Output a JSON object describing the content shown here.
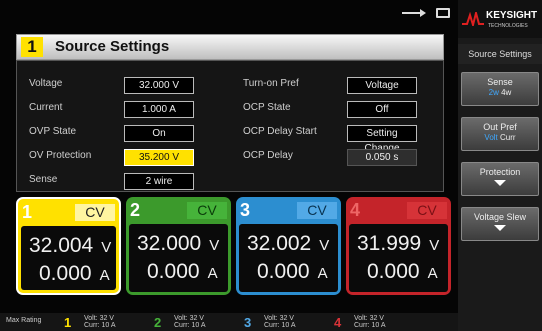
{
  "title": {
    "number": "1",
    "text": "Source Settings"
  },
  "settings_left": [
    {
      "label": "Voltage",
      "value": "32.000 V"
    },
    {
      "label": "Current",
      "value": "1.000 A"
    },
    {
      "label": "OVP State",
      "value": "On"
    },
    {
      "label": "OV Protection",
      "value": "35.200 V"
    },
    {
      "label": "Sense",
      "value": "2 wire"
    }
  ],
  "settings_right": [
    {
      "label": "Turn-on Pref",
      "value": "Voltage"
    },
    {
      "label": "OCP State",
      "value": "Off"
    },
    {
      "label": "OCP Delay Start",
      "value": "Setting Change"
    },
    {
      "label": "OCP Delay",
      "value": "0.050 s"
    }
  ],
  "channels": [
    {
      "num": "1",
      "mode": "CV",
      "voltage": "32.004",
      "v_unit": "V",
      "current": "0.000",
      "a_unit": "A"
    },
    {
      "num": "2",
      "mode": "CV",
      "voltage": "32.000",
      "v_unit": "V",
      "current": "0.000",
      "a_unit": "A"
    },
    {
      "num": "3",
      "mode": "CV",
      "voltage": "32.002",
      "v_unit": "V",
      "current": "0.000",
      "a_unit": "A"
    },
    {
      "num": "4",
      "mode": "CV",
      "voltage": "31.999",
      "v_unit": "V",
      "current": "0.000",
      "a_unit": "A"
    }
  ],
  "max_rating": {
    "label": "Max Rating",
    "items": [
      {
        "num": "1",
        "volt": "Volt:   32  V",
        "curr": "Curr:   10  A"
      },
      {
        "num": "2",
        "volt": "Volt:   32  V",
        "curr": "Curr:   10  A"
      },
      {
        "num": "3",
        "volt": "Volt:   32  V",
        "curr": "Curr:   10  A"
      },
      {
        "num": "4",
        "volt": "Volt:   32  V",
        "curr": "Curr:   10  A"
      }
    ]
  },
  "brand": {
    "name": "KEYSIGHT",
    "sub": "TECHNOLOGIES"
  },
  "softkeys": {
    "title": "Source Settings",
    "sense": {
      "label": "Sense",
      "opt1": "2w",
      "opt2": "4w"
    },
    "outpref": {
      "label": "Out Pref",
      "opt1": "Volt",
      "opt2": "Curr"
    },
    "protection": {
      "label": "Protection"
    },
    "slew": {
      "label": "Voltage Slew"
    }
  },
  "icons": {
    "usb": "usb-icon",
    "display": "monitor-icon",
    "logo": "keysight-wave-icon",
    "down": "down-arrow-icon"
  },
  "colors": {
    "ch1": "#ffe100",
    "ch2": "#3c9a2c",
    "ch3": "#2c8ed0",
    "ch4": "#c4242a",
    "highlight": "#ffe100",
    "selected": "#3fa9ff"
  }
}
